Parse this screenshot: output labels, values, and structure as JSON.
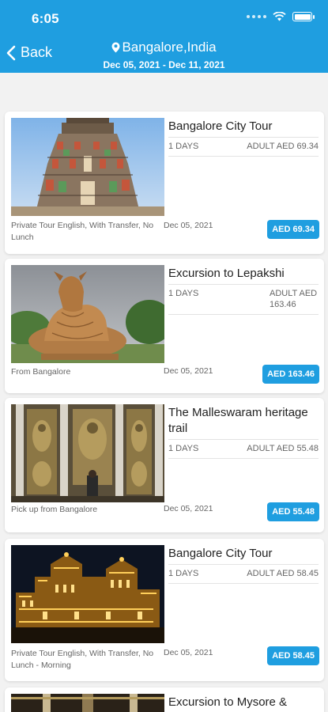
{
  "status": {
    "time": "6:05"
  },
  "header": {
    "back_label": "Back",
    "title": "Bangalore,India",
    "dates": "Dec 05, 2021 - Dec 11, 2021"
  },
  "colors": {
    "accent": "#1f9ee0"
  },
  "tours": [
    {
      "title": "Bangalore City Tour",
      "days": "1 DAYS",
      "adult_price": "ADULT AED 69.34",
      "note": "Private Tour English, With Transfer, No Lunch",
      "date": "Dec 05, 2021",
      "price": "AED 69.34",
      "image": "temple-gopuram"
    },
    {
      "title": "Excursion to Lepakshi",
      "days": "1 DAYS",
      "adult_price": "ADULT AED 163.46",
      "note": "From Bangalore",
      "date": "Dec 05, 2021",
      "price": "AED 163.46",
      "image": "nandi-statue"
    },
    {
      "title": "The Malleswaram heritage trail",
      "days": "1 DAYS",
      "adult_price": "ADULT AED 55.48",
      "note": "Pick up from Bangalore",
      "date": "Dec 05, 2021",
      "price": "AED 55.48",
      "image": "carved-temple-wall"
    },
    {
      "title": "Bangalore City Tour",
      "days": "1 DAYS",
      "adult_price": "ADULT AED 58.45",
      "note": "Private Tour English, With Transfer, No Lunch - Morning",
      "date": "Dec 05, 2021",
      "price": "AED 58.45",
      "image": "illuminated-palace"
    },
    {
      "title": "Excursion to Mysore &",
      "image": "palace-interior"
    }
  ]
}
